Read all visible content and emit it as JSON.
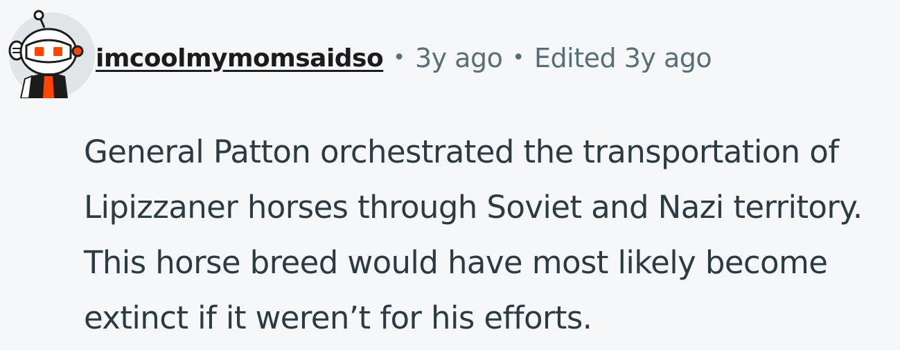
{
  "comment": {
    "author": {
      "username": "imcoolmymomsaidso",
      "avatar_icon": "snoo-avatar-icon"
    },
    "separator_1": "•",
    "timestamp": "3y ago",
    "separator_2": "•",
    "edited": "Edited 3y ago",
    "body": "General Patton orchestrated the transportation of Lipizzaner horses through Soviet and Nazi territory. This horse breed would have most likely become extinct if it weren’t for his efforts."
  },
  "colors": {
    "background": "#f6f7f8",
    "username": "#1c1c1c",
    "meta_text": "#576f76",
    "body_text": "#2a3c42",
    "avatar_bg": "#dfe5e8",
    "avatar_accent": "#ff4500"
  }
}
